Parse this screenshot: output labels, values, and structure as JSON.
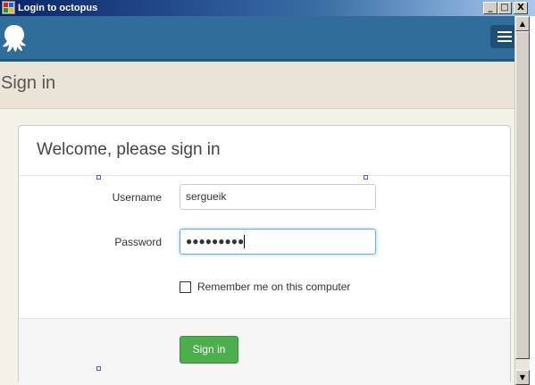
{
  "window": {
    "title": "Login to octopus",
    "minimize_label": "_",
    "maximize_label": "□",
    "close_label": "X"
  },
  "header": {
    "logo": "octopus-icon",
    "menu": "hamburger-menu-icon",
    "brand_color": "#2f6d9b"
  },
  "page": {
    "title": "Sign in"
  },
  "panel": {
    "heading": "Welcome, please sign in",
    "username_label": "Username",
    "username_value": "sergueik",
    "password_label": "Password",
    "password_value": "●●●●●●●●●",
    "remember_label": "Remember me on this computer",
    "remember_checked": false,
    "signin_label": "Sign in",
    "signin_color": "#4cae4c"
  },
  "scrollbar": {
    "up_arrow": "▲",
    "down_arrow": "▼"
  }
}
